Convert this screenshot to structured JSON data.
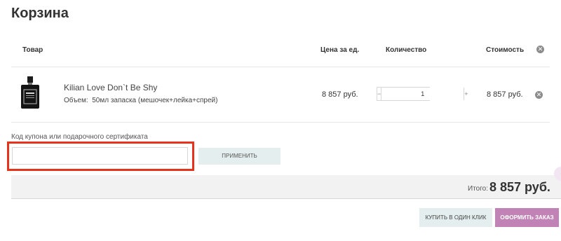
{
  "page": {
    "title": "Корзина"
  },
  "columns": {
    "product": "Товар",
    "unit_price": "Цена за ед.",
    "quantity": "Количество",
    "total": "Стоимость"
  },
  "items": [
    {
      "name": "Kilian Love Don`t Be Shy",
      "volume_label": "Объем:",
      "volume_value": "50мл запаска (мешочек+лейка+спрей)",
      "unit_price": "8 857 руб.",
      "quantity": "1",
      "total": "8 857 руб."
    }
  ],
  "icons": {
    "clear_all": "close-circle-icon",
    "remove": "close-circle-icon",
    "minus": "minus-icon",
    "plus": "plus-icon"
  },
  "coupon": {
    "label": "Код купона или подарочного сертификата",
    "value": "",
    "apply_label": "ПРИМЕНИТЬ"
  },
  "summary": {
    "total_label": "Итого:",
    "total_value": "8 857 руб."
  },
  "actions": {
    "one_click": "КУПИТЬ В ОДИН КЛИК",
    "checkout": "ОФОРМИТЬ ЗАКАЗ"
  },
  "colors": {
    "checkout": "#c183b5",
    "secondary_button": "#e5eeee",
    "highlight": "#e5341b",
    "total_bar": "#f2f2f2"
  }
}
